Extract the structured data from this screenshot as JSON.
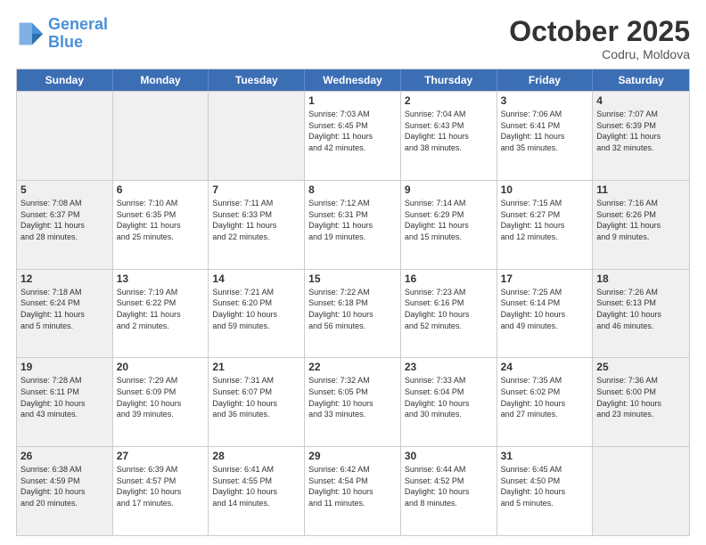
{
  "header": {
    "logo_line1": "General",
    "logo_line2": "Blue",
    "month": "October 2025",
    "location": "Codru, Moldova"
  },
  "days_of_week": [
    "Sunday",
    "Monday",
    "Tuesday",
    "Wednesday",
    "Thursday",
    "Friday",
    "Saturday"
  ],
  "weeks": [
    [
      {
        "day": "",
        "info": "",
        "shaded": true
      },
      {
        "day": "",
        "info": "",
        "shaded": true
      },
      {
        "day": "",
        "info": "",
        "shaded": true
      },
      {
        "day": "1",
        "info": "Sunrise: 7:03 AM\nSunset: 6:45 PM\nDaylight: 11 hours\nand 42 minutes.",
        "shaded": false
      },
      {
        "day": "2",
        "info": "Sunrise: 7:04 AM\nSunset: 6:43 PM\nDaylight: 11 hours\nand 38 minutes.",
        "shaded": false
      },
      {
        "day": "3",
        "info": "Sunrise: 7:06 AM\nSunset: 6:41 PM\nDaylight: 11 hours\nand 35 minutes.",
        "shaded": false
      },
      {
        "day": "4",
        "info": "Sunrise: 7:07 AM\nSunset: 6:39 PM\nDaylight: 11 hours\nand 32 minutes.",
        "shaded": true
      }
    ],
    [
      {
        "day": "5",
        "info": "Sunrise: 7:08 AM\nSunset: 6:37 PM\nDaylight: 11 hours\nand 28 minutes.",
        "shaded": true
      },
      {
        "day": "6",
        "info": "Sunrise: 7:10 AM\nSunset: 6:35 PM\nDaylight: 11 hours\nand 25 minutes.",
        "shaded": false
      },
      {
        "day": "7",
        "info": "Sunrise: 7:11 AM\nSunset: 6:33 PM\nDaylight: 11 hours\nand 22 minutes.",
        "shaded": false
      },
      {
        "day": "8",
        "info": "Sunrise: 7:12 AM\nSunset: 6:31 PM\nDaylight: 11 hours\nand 19 minutes.",
        "shaded": false
      },
      {
        "day": "9",
        "info": "Sunrise: 7:14 AM\nSunset: 6:29 PM\nDaylight: 11 hours\nand 15 minutes.",
        "shaded": false
      },
      {
        "day": "10",
        "info": "Sunrise: 7:15 AM\nSunset: 6:27 PM\nDaylight: 11 hours\nand 12 minutes.",
        "shaded": false
      },
      {
        "day": "11",
        "info": "Sunrise: 7:16 AM\nSunset: 6:26 PM\nDaylight: 11 hours\nand 9 minutes.",
        "shaded": true
      }
    ],
    [
      {
        "day": "12",
        "info": "Sunrise: 7:18 AM\nSunset: 6:24 PM\nDaylight: 11 hours\nand 5 minutes.",
        "shaded": true
      },
      {
        "day": "13",
        "info": "Sunrise: 7:19 AM\nSunset: 6:22 PM\nDaylight: 11 hours\nand 2 minutes.",
        "shaded": false
      },
      {
        "day": "14",
        "info": "Sunrise: 7:21 AM\nSunset: 6:20 PM\nDaylight: 10 hours\nand 59 minutes.",
        "shaded": false
      },
      {
        "day": "15",
        "info": "Sunrise: 7:22 AM\nSunset: 6:18 PM\nDaylight: 10 hours\nand 56 minutes.",
        "shaded": false
      },
      {
        "day": "16",
        "info": "Sunrise: 7:23 AM\nSunset: 6:16 PM\nDaylight: 10 hours\nand 52 minutes.",
        "shaded": false
      },
      {
        "day": "17",
        "info": "Sunrise: 7:25 AM\nSunset: 6:14 PM\nDaylight: 10 hours\nand 49 minutes.",
        "shaded": false
      },
      {
        "day": "18",
        "info": "Sunrise: 7:26 AM\nSunset: 6:13 PM\nDaylight: 10 hours\nand 46 minutes.",
        "shaded": true
      }
    ],
    [
      {
        "day": "19",
        "info": "Sunrise: 7:28 AM\nSunset: 6:11 PM\nDaylight: 10 hours\nand 43 minutes.",
        "shaded": true
      },
      {
        "day": "20",
        "info": "Sunrise: 7:29 AM\nSunset: 6:09 PM\nDaylight: 10 hours\nand 39 minutes.",
        "shaded": false
      },
      {
        "day": "21",
        "info": "Sunrise: 7:31 AM\nSunset: 6:07 PM\nDaylight: 10 hours\nand 36 minutes.",
        "shaded": false
      },
      {
        "day": "22",
        "info": "Sunrise: 7:32 AM\nSunset: 6:05 PM\nDaylight: 10 hours\nand 33 minutes.",
        "shaded": false
      },
      {
        "day": "23",
        "info": "Sunrise: 7:33 AM\nSunset: 6:04 PM\nDaylight: 10 hours\nand 30 minutes.",
        "shaded": false
      },
      {
        "day": "24",
        "info": "Sunrise: 7:35 AM\nSunset: 6:02 PM\nDaylight: 10 hours\nand 27 minutes.",
        "shaded": false
      },
      {
        "day": "25",
        "info": "Sunrise: 7:36 AM\nSunset: 6:00 PM\nDaylight: 10 hours\nand 23 minutes.",
        "shaded": true
      }
    ],
    [
      {
        "day": "26",
        "info": "Sunrise: 6:38 AM\nSunset: 4:59 PM\nDaylight: 10 hours\nand 20 minutes.",
        "shaded": true
      },
      {
        "day": "27",
        "info": "Sunrise: 6:39 AM\nSunset: 4:57 PM\nDaylight: 10 hours\nand 17 minutes.",
        "shaded": false
      },
      {
        "day": "28",
        "info": "Sunrise: 6:41 AM\nSunset: 4:55 PM\nDaylight: 10 hours\nand 14 minutes.",
        "shaded": false
      },
      {
        "day": "29",
        "info": "Sunrise: 6:42 AM\nSunset: 4:54 PM\nDaylight: 10 hours\nand 11 minutes.",
        "shaded": false
      },
      {
        "day": "30",
        "info": "Sunrise: 6:44 AM\nSunset: 4:52 PM\nDaylight: 10 hours\nand 8 minutes.",
        "shaded": false
      },
      {
        "day": "31",
        "info": "Sunrise: 6:45 AM\nSunset: 4:50 PM\nDaylight: 10 hours\nand 5 minutes.",
        "shaded": false
      },
      {
        "day": "",
        "info": "",
        "shaded": true
      }
    ]
  ]
}
